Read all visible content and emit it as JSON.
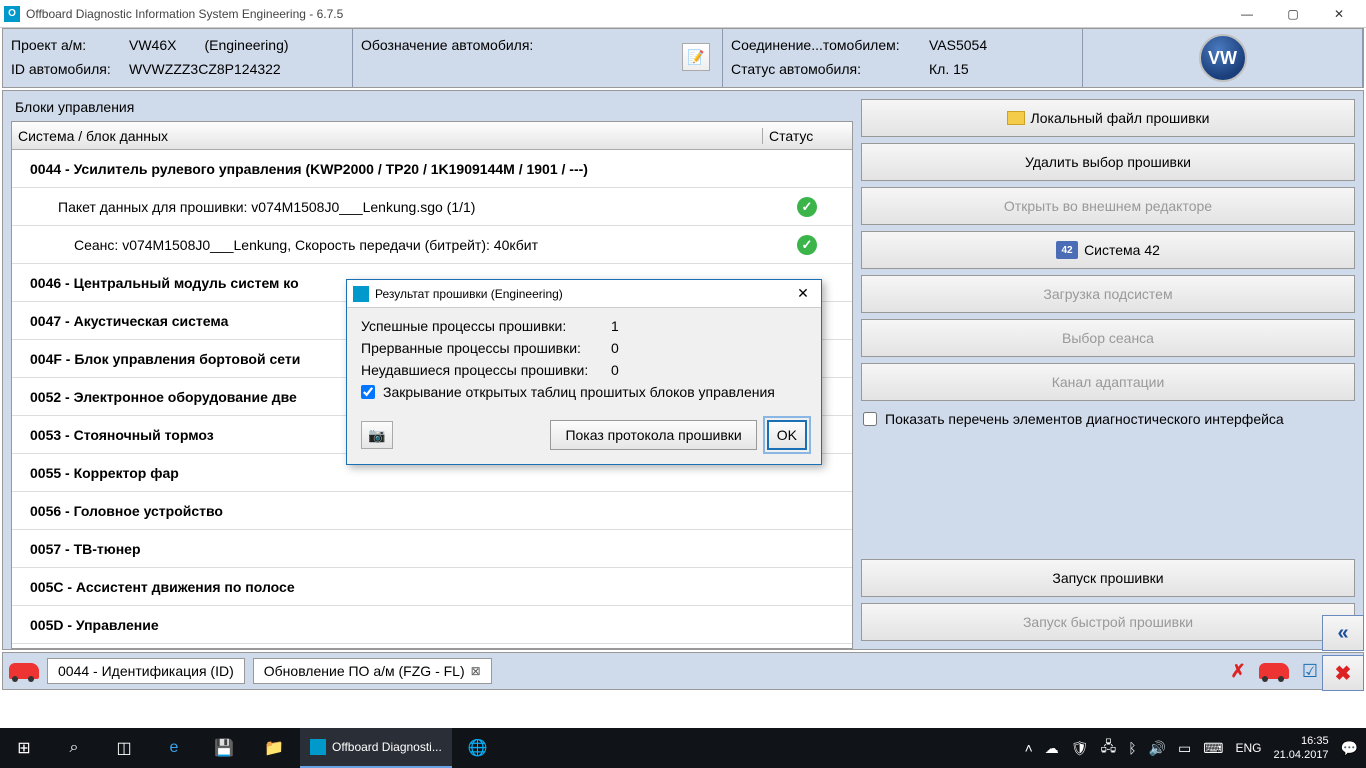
{
  "title": "Offboard Diagnostic Information System Engineering - 6.7.5",
  "header": {
    "project_label": "Проект а/м:",
    "project_value": "VW46X",
    "project_mode": "(Engineering)",
    "vehicle_id_label": "ID автомобиля:",
    "vehicle_id_value": "WVWZZZ3CZ8P124322",
    "vehicle_desig_label": "Обозначение автомобиля:",
    "connection_label": "Соединение...томобилем:",
    "connection_value": "VAS5054",
    "vehicle_status_label": "Статус автомобиля:",
    "vehicle_status_value": "Кл. 15"
  },
  "section_title": "Блоки управления",
  "table": {
    "col1": "Система / блок данных",
    "col2": "Статус"
  },
  "rows": [
    {
      "text": "0044 - Усилитель рулевого управления  (KWP2000 / TP20 / 1K1909144M / 1901 / ---)",
      "bold": true
    },
    {
      "text": "Пакет данных для прошивки: v074M1508J0___Lenkung.sgo (1/1)",
      "sub": true,
      "ok": true
    },
    {
      "text": "Сеанс: v074M1508J0___Lenkung, Скорость передачи (битрейт): 40кбит",
      "sub2": true,
      "ok": true
    },
    {
      "text": "0046 - Центральный модуль систем ко",
      "bold": true
    },
    {
      "text": "0047 - Акустическая система",
      "bold": true
    },
    {
      "text": "004F - Блок управления бортовой сети",
      "bold": true
    },
    {
      "text": "0052 - Электронное оборудование две",
      "bold": true
    },
    {
      "text": "0053 - Стояночный тормоз",
      "bold": true
    },
    {
      "text": "0055 - Корректор фар",
      "bold": true
    },
    {
      "text": "0056 - Головное устройство",
      "bold": true
    },
    {
      "text": "0057 - ТВ-тюнер",
      "bold": true
    },
    {
      "text": "005C - Ассистент движения по полосе",
      "bold": true
    },
    {
      "text": "005D - Управление",
      "bold": true
    }
  ],
  "right_buttons": {
    "local_fw": "Локальный файл прошивки",
    "delete_sel": "Удалить выбор прошивки",
    "open_ext": "Открыть во внешнем редакторе",
    "system42": "Система 42",
    "load_sub": "Загрузка подсистем",
    "sel_session": "Выбор сеанса",
    "adapt_chan": "Канал адаптации",
    "show_diag": "Показать перечень элементов диагностического интерфейса",
    "start_fw": "Запуск прошивки",
    "start_fast": "Запуск быстрой прошивки"
  },
  "tabs": {
    "tab1": "0044 - Идентификация (ID)",
    "tab2": "Обновление ПО а/м (FZG - FL)"
  },
  "dialog": {
    "title": "Результат прошивки (Engineering)",
    "r1l": "Успешные процессы прошивки:",
    "r1v": "1",
    "r2l": "Прерванные процессы прошивки:",
    "r2v": "0",
    "r3l": "Неудавшиеся процессы прошивки:",
    "r3v": "0",
    "chk": "Закрывание открытых таблиц прошитых блоков управления",
    "btn_proto": "Показ протокола прошивки",
    "btn_ok": "OK"
  },
  "taskbar": {
    "app1": "Offboard Diagnosti...",
    "lang": "ENG",
    "time": "16:35",
    "date": "21.04.2017"
  },
  "logo_text": "VW"
}
